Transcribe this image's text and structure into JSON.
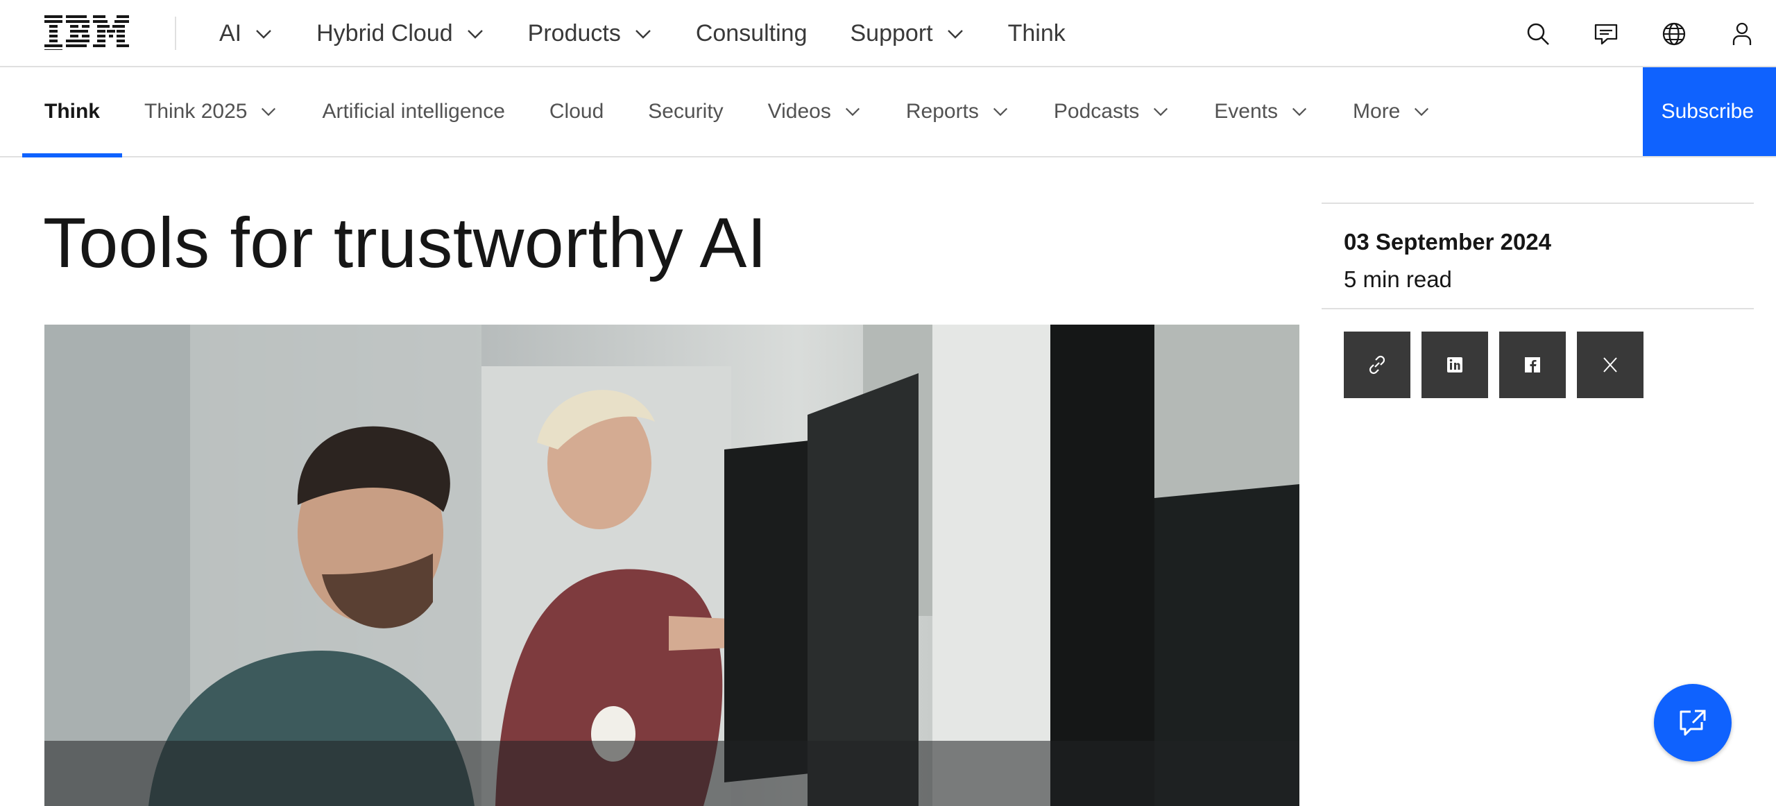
{
  "brand": {
    "name": "IBM",
    "accent": "#0f62fe"
  },
  "masthead": {
    "nav": [
      {
        "label": "AI",
        "dropdown": true
      },
      {
        "label": "Hybrid Cloud",
        "dropdown": true
      },
      {
        "label": "Products",
        "dropdown": true
      },
      {
        "label": "Consulting",
        "dropdown": false
      },
      {
        "label": "Support",
        "dropdown": true
      },
      {
        "label": "Think",
        "dropdown": false
      }
    ],
    "icons": [
      "search-icon",
      "chat-icon",
      "globe-icon",
      "user-icon"
    ]
  },
  "subnav": {
    "items": [
      {
        "label": "Think",
        "dropdown": false,
        "active": true
      },
      {
        "label": "Think 2025",
        "dropdown": true
      },
      {
        "label": "Artificial intelligence",
        "dropdown": false
      },
      {
        "label": "Cloud",
        "dropdown": false
      },
      {
        "label": "Security",
        "dropdown": false
      },
      {
        "label": "Videos",
        "dropdown": true
      },
      {
        "label": "Reports",
        "dropdown": true
      },
      {
        "label": "Podcasts",
        "dropdown": true
      },
      {
        "label": "Events",
        "dropdown": true
      },
      {
        "label": "More",
        "dropdown": true
      }
    ],
    "subscribe_label": "Subscribe"
  },
  "article": {
    "title": "Tools for trustworthy AI",
    "date": "03 September 2024",
    "read_time": "5 min read",
    "share": [
      "link-icon",
      "linkedin-icon",
      "facebook-icon",
      "x-icon"
    ]
  },
  "fab": {
    "icon": "chat-launch-icon"
  }
}
